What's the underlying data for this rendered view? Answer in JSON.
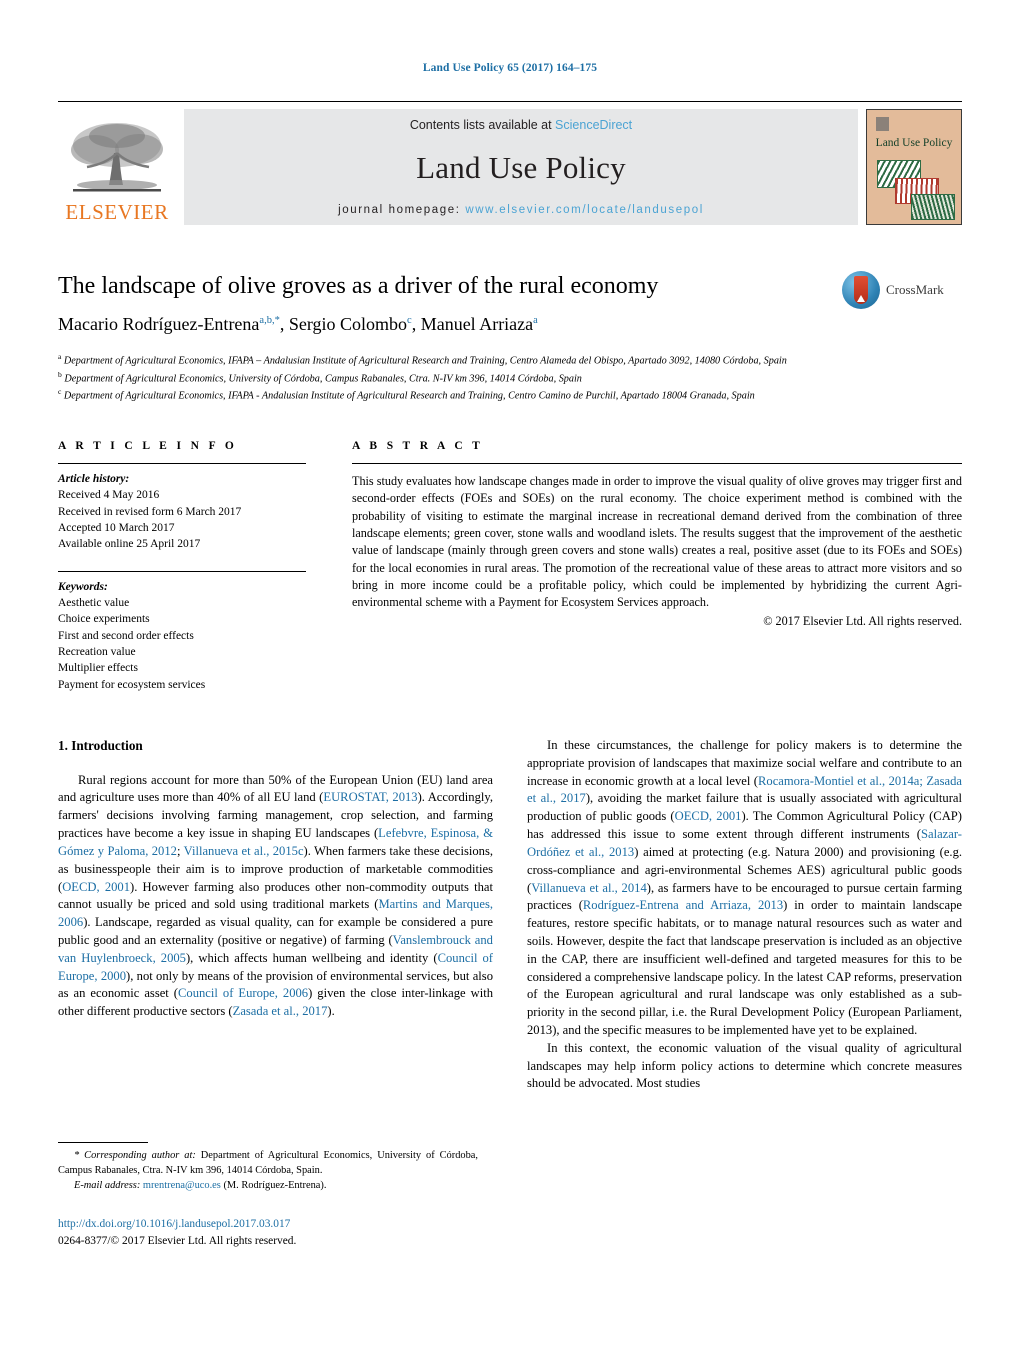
{
  "running_head": "Land Use Policy 65 (2017) 164–175",
  "masthead": {
    "contents_prefix": "Contents lists available at ",
    "sciencedirect": "ScienceDirect",
    "journal_title": "Land Use Policy",
    "homepage_prefix": "journal homepage: ",
    "homepage_url": "www.elsevier.com/locate/landusepol",
    "publisher": "ELSEVIER",
    "cover_title": "Land Use Policy",
    "link_color": "#4ba3d3",
    "masthead_bg": "#e6e7e8",
    "cover_bg": "#e3bb9a",
    "elsevier_orange": "#E87722"
  },
  "title_block": {
    "title": "The landscape of olive groves as a driver of the rural economy",
    "authors_plain": "Macario Rodríguez-Entrena",
    "authors": [
      {
        "name": "Macario Rodríguez-Entrena",
        "sup": "a,b,*"
      },
      {
        "name": "Sergio Colombo",
        "sup": "c"
      },
      {
        "name": "Manuel Arriaza",
        "sup": "a"
      }
    ],
    "crossmark_label": "CrossMark"
  },
  "affiliations": [
    {
      "marker": "a",
      "text": "Department of Agricultural Economics, IFAPA – Andalusian Institute of Agricultural Research and Training, Centro Alameda del Obispo, Apartado 3092, 14080 Córdoba, Spain"
    },
    {
      "marker": "b",
      "text": "Department of Agricultural Economics, University of Córdoba, Campus Rabanales, Ctra. N-IV km 396, 14014 Córdoba, Spain"
    },
    {
      "marker": "c",
      "text": "Department of Agricultural Economics, IFAPA - Andalusian Institute of Agricultural Research and Training, Centro Camino de Purchil, Apartado 18004 Granada, Spain"
    }
  ],
  "article_info": {
    "heading": "A R T I C L E   I N F O",
    "history_label": "Article history:",
    "history": [
      "Received 4 May 2016",
      "Received in revised form 6 March 2017",
      "Accepted 10 March 2017",
      "Available online 25 April 2017"
    ],
    "keywords_label": "Keywords:",
    "keywords": [
      "Aesthetic value",
      "Choice experiments",
      "First and second order effects",
      "Recreation value",
      "Multiplier effects",
      "Payment for ecosystem services"
    ]
  },
  "abstract": {
    "heading": "A B S T R A C T",
    "text": "This study evaluates how landscape changes made in order to improve the visual quality of olive groves may trigger first and second-order effects (FOEs and SOEs) on the rural economy. The choice experiment method is combined with the probability of visiting to estimate the marginal increase in recreational demand derived from the combination of three landscape elements; green cover, stone walls and woodland islets. The results suggest that the improvement of the aesthetic value of landscape (mainly through green covers and stone walls) creates a real, positive asset (due to its FOEs and SOEs) for the local economies in rural areas. The promotion of the recreational value of these areas to attract more visitors and so bring in more income could be a profitable policy, which could be implemented by hybridizing the current Agri-environmental scheme with a Payment for Ecosystem Services approach.",
    "copyright": "© 2017 Elsevier Ltd. All rights reserved."
  },
  "body": {
    "section_heading": "1. Introduction",
    "left_paragraph_1_a": "Rural regions account for more than 50% of the European Union (EU) land area and agriculture uses more than 40% of all EU land (",
    "ref_eurostat": "EUROSTAT, 2013",
    "left_paragraph_1_b": "). Accordingly, farmers' decisions involving farming management, crop selection, and farming practices have become a key issue in shaping EU landscapes (",
    "ref_lefebvre": "Lefebvre, Espinosa, & Gómez y Paloma, 2012",
    "left_sep_1": "; ",
    "ref_villanueva_c": "Villanueva et al., 2015c",
    "left_paragraph_1_c": "). When farmers take these decisions, as businesspeople their aim is to improve production of marketable commodities (",
    "ref_oecd_2001a": "OECD, 2001",
    "left_paragraph_1_d": "). However farming also produces other non-commodity outputs that cannot usually be priced and sold using traditional markets (",
    "ref_martins": "Martins and Marques, 2006",
    "left_paragraph_1_e": "). Landscape, regarded as visual quality, can for example be considered a pure public good and an externality (positive or negative) of farming (",
    "ref_vanslembrouck": "Vanslembrouck and van Huylenbroeck, 2005",
    "left_paragraph_1_f": "), which affects human wellbeing and identity (",
    "ref_coe_2000": "Council of Europe, 2000",
    "left_paragraph_1_g": "), not only by means of the provision of environmental services, but also as an economic asset (",
    "ref_coe_2006": "Council of Europe, 2006",
    "left_paragraph_1_h": ") given the close inter-linkage with other different productive sectors (",
    "ref_zasada_a": "Zasada et al., 2017",
    "left_paragraph_1_i": ").",
    "right_paragraph_1_a": "In these circumstances, the challenge for policy makers is to determine the appropriate provision of landscapes that maximize social welfare and contribute to an increase in economic growth at a local level (",
    "ref_rocamora": "Rocamora-Montiel et al., 2014a; Zasada et al., 2017",
    "right_paragraph_1_b": "), avoiding the market failure that is usually associated with agricultural production of public goods (",
    "ref_oecd_2001b": "OECD, 2001",
    "right_paragraph_1_c": "). The Common Agricultural Policy (CAP) has addressed this issue to some extent through different instruments (",
    "ref_salazar": "Salazar-Ordóñez et al., 2013",
    "right_paragraph_1_d": ") aimed at protecting (e.g. Natura 2000) and provisioning (e.g. cross-compliance and agri-environmental Schemes AES) agricultural public goods (",
    "ref_villanueva_2014": "Villanueva et al., 2014",
    "right_paragraph_1_e": "), as farmers have to be encouraged to pursue certain farming practices (",
    "ref_rodriguez_arriaza": "Rodríguez-Entrena and Arriaza, 2013",
    "right_paragraph_1_f": ") in order to maintain landscape features, restore specific habitats, or to manage natural resources such as water and soils. However, despite the fact that landscape preservation is included as an objective in the CAP, there are insufficient well-defined and targeted measures for this to be considered a comprehensive landscape policy. In the latest CAP reforms, preservation of the European agricultural and rural landscape was only established as a sub-priority in the second pillar, i.e. the Rural Development Policy (European Parliament, 2013), and the specific measures to be implemented have yet to be explained.",
    "right_paragraph_2": "In this context, the economic valuation of the visual quality of agricultural landscapes may help inform policy actions to determine which concrete measures should be advocated. Most studies"
  },
  "footnotes": {
    "corresponding_star": "*",
    "corresponding_label": " Corresponding author at: ",
    "corresponding_text": "Department of Agricultural Economics, University of Córdoba, Campus Rabanales, Ctra. N-IV km 396, 14014 Córdoba, Spain.",
    "email_label": "E-mail address:",
    "email": "mrentrena@uco.es",
    "email_owner": " (M. Rodríguez-Entrena).",
    "doi": "http://dx.doi.org/10.1016/j.landusepol.2017.03.017",
    "issn_copyright": "0264-8377/© 2017 Elsevier Ltd. All rights reserved."
  }
}
